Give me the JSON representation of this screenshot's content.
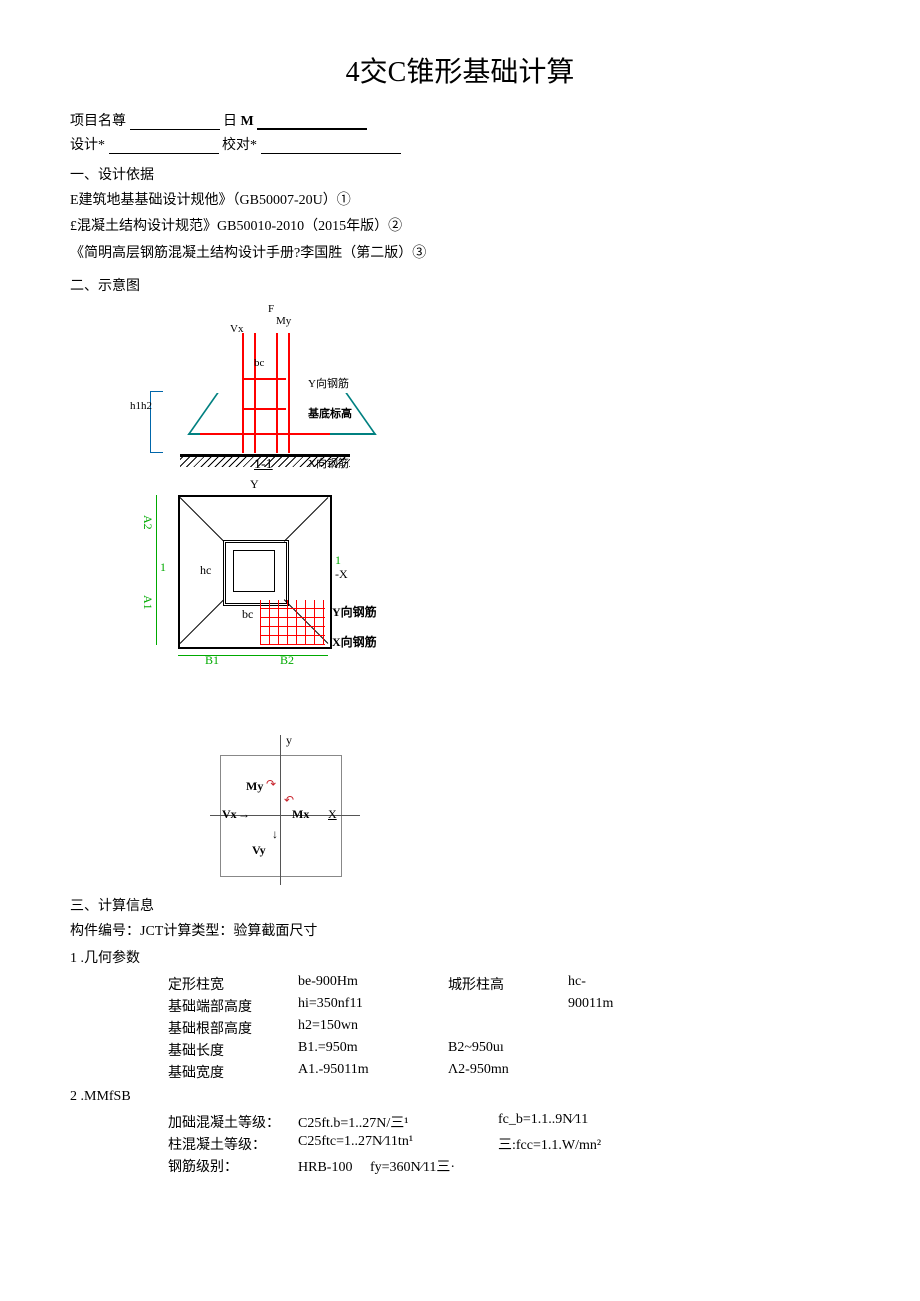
{
  "title": "4交C锥形基础计算",
  "header": {
    "proj_label": "项目名尊",
    "date_label": "日",
    "date_m": "M",
    "design_label": "设计*",
    "check_label": "校对*"
  },
  "sec1": {
    "heading": "一、设计依据",
    "line1": "E建筑地基基础设计规他》（GB50007-20U）①",
    "line2": "£混凝土结构设计规范》GB50010-2010（2015年版）②",
    "line3": "《简明高层钢筋混凝土结构设计手册?李国胜（第二版）③"
  },
  "sec2": {
    "heading": "二、示意图",
    "dia1": {
      "F": "F",
      "My": "My",
      "Vx": "Vx",
      "bc": "bc",
      "yrebar": "Y向钢筋",
      "base_el": "基底标高",
      "sect": "1-1",
      "xrebar": "X向钢筋",
      "h1h2": "h1h2"
    },
    "dia2": {
      "Y": "Y",
      "A2": "A2",
      "one_a": "1",
      "hc": "hc",
      "one_b": "1",
      "X": "X",
      "A1": "A1",
      "bc": "bc",
      "yrebar": "Y向钢筋",
      "xrebar": "X向钢筋",
      "B1": "B1",
      "B2": "B2"
    },
    "dia3": {
      "y": "y",
      "My": "My",
      "Vx": "Vx",
      "Mx": "Mx",
      "X": "X",
      "Vy": "Vy"
    }
  },
  "sec3": {
    "heading": "三、计算信息",
    "component_line": "构件编号：JCT计算类型：验算截面尺寸",
    "sub1_num": "1",
    "sub1_title": ".几何参数",
    "geom": {
      "r1": {
        "l1": "定形柱宽",
        "v1": "be-900Hm",
        "l2": "城形柱高",
        "v2": "hc-"
      },
      "r2": {
        "l1": "基础端部高度",
        "v1": "hi=350nf11",
        "l2": "",
        "v2": "90011m"
      },
      "r3": {
        "l1": "基础根部高度",
        "v1": "h2=150wn",
        "l2": "",
        "v2": ""
      },
      "r4": {
        "l1": "基础长度",
        "v1": "B1.=950m",
        "l2": "B2~950uı",
        "v2": ""
      },
      "r5": {
        "l1": "基础宽度",
        "v1": "A1.-95011m",
        "l2": "Λ2-950mn",
        "v2": ""
      }
    },
    "sub2_num": "2",
    "sub2_title": ".MMfSB",
    "mat": {
      "r1": {
        "l": "加础混凝土等级：",
        "m": "C25ft.b=1..27N/三¹",
        "r": "fc_b=1.1..9N⁄11"
      },
      "r2": {
        "l": "柱混凝土等级：",
        "m": "C25ftc=1..27N⁄11tn¹",
        "r": "三:fcc=1.1.W/mn²"
      },
      "r3": {
        "l": "钢筋级别：",
        "m": "HRB-100     fy=360N⁄11三·",
        "r": ""
      }
    }
  }
}
